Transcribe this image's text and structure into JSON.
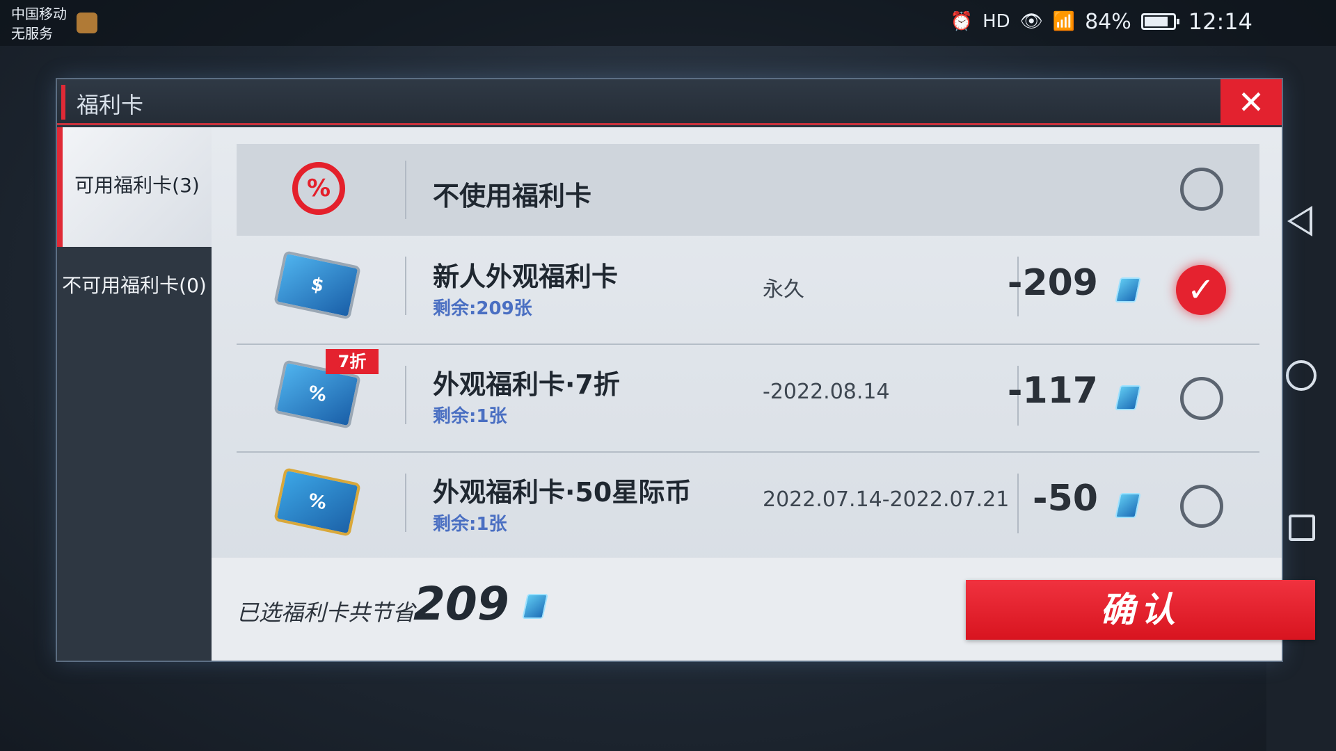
{
  "status_bar": {
    "carrier": "中国移动",
    "service": "无服务",
    "battery": "84%",
    "battery_level": 0.84,
    "time": "12:14"
  },
  "dialog": {
    "title": "福利卡",
    "close_label": "✕"
  },
  "tabs": [
    {
      "label": "可用福利卡(3)",
      "active": true
    },
    {
      "label": "不可用福利卡(0)",
      "active": false
    }
  ],
  "no_card": {
    "label": "不使用福利卡",
    "icon_glyph": "%"
  },
  "cards": [
    {
      "name": "新人外观福利卡",
      "remaining": "剩余:209张",
      "validity": "永久",
      "value": "-209",
      "selected": true,
      "icon": "shirt-dollar-card-icon",
      "icon_glyph": "$",
      "tag": ""
    },
    {
      "name": "外观福利卡·7折",
      "remaining": "剩余:1张",
      "validity": "-2022.08.14",
      "value": "-117",
      "selected": false,
      "icon": "shirt-percent-card-icon",
      "icon_glyph": "%",
      "tag": "7折"
    },
    {
      "name": "外观福利卡·50星际币",
      "remaining": "剩余:1张",
      "validity": "2022.07.14-2022.07.21",
      "value": "-50",
      "selected": false,
      "icon": "gold-shirt-percent-card-icon",
      "icon_glyph": "%",
      "tag": ""
    }
  ],
  "footer": {
    "label": "已选福利卡共节省",
    "value": "209",
    "confirm": "确认"
  },
  "colors": {
    "accent_red": "#e3222f",
    "link_blue": "#4a6fc2"
  }
}
